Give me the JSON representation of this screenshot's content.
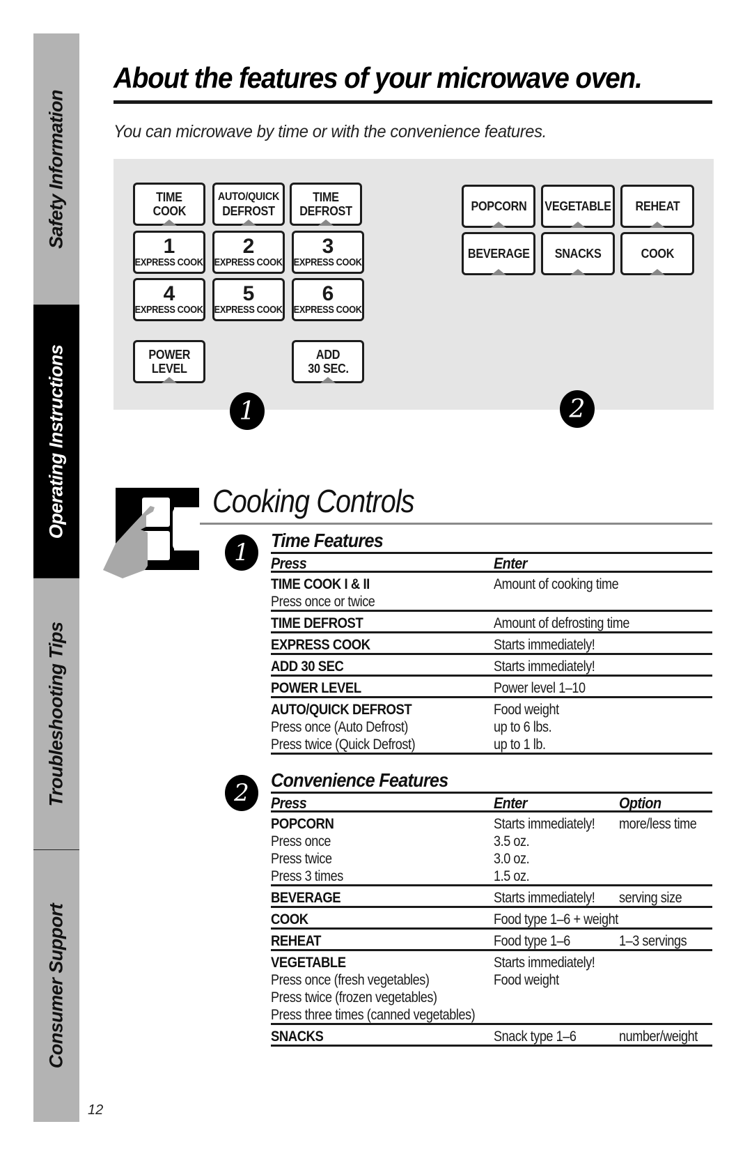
{
  "side_tabs": [
    {
      "label": "Safety Information",
      "active": false
    },
    {
      "label": "Operating Instructions",
      "active": true
    },
    {
      "label": "Troubleshooting Tips",
      "active": false
    },
    {
      "label": "Consumer Support",
      "active": false
    }
  ],
  "page_number": "12",
  "header": {
    "title": "About the features of your microwave oven.",
    "subtitle": "You can microwave by time or with the convenience features."
  },
  "panel": {
    "group1_badge": "1",
    "group2_badge": "2",
    "group1_keys": [
      {
        "line1": "TIME",
        "line2": "COOK"
      },
      {
        "line1": "AUTO/QUICK",
        "line2": "DEFROST"
      },
      {
        "line1": "TIME",
        "line2": "DEFROST"
      },
      {
        "num": "1",
        "sub": "EXPRESS COOK"
      },
      {
        "num": "2",
        "sub": "EXPRESS COOK"
      },
      {
        "num": "3",
        "sub": "EXPRESS COOK"
      },
      {
        "num": "4",
        "sub": "EXPRESS COOK"
      },
      {
        "num": "5",
        "sub": "EXPRESS COOK"
      },
      {
        "num": "6",
        "sub": "EXPRESS COOK"
      },
      {
        "line1": "POWER",
        "line2": "LEVEL"
      },
      {
        "line1": "ADD",
        "line2": "30 SEC."
      }
    ],
    "group2_keys": [
      {
        "label": "POPCORN"
      },
      {
        "label": "VEGETABLE"
      },
      {
        "label": "REHEAT"
      },
      {
        "label": "BEVERAGE"
      },
      {
        "label": "SNACKS"
      },
      {
        "label": "COOK"
      }
    ]
  },
  "cooking_controls": {
    "title": "Cooking Controls",
    "time_features": {
      "badge": "1",
      "title": "Time Features",
      "headers": {
        "press": "Press",
        "enter": "Enter"
      },
      "rows": [
        {
          "lines": [
            {
              "press": "TIME COOK I & II",
              "enter": "Amount of cooking time"
            },
            {
              "press": "Press once or twice",
              "enter": ""
            }
          ]
        },
        {
          "lines": [
            {
              "press": "TIME DEFROST",
              "enter": "Amount of defrosting time"
            }
          ]
        },
        {
          "lines": [
            {
              "press": "EXPRESS COOK",
              "enter": "Starts immediately!"
            }
          ]
        },
        {
          "lines": [
            {
              "press": "ADD 30 SEC",
              "enter": "Starts immediately!"
            }
          ]
        },
        {
          "lines": [
            {
              "press": "POWER LEVEL",
              "enter": "Power level 1–10"
            }
          ]
        },
        {
          "lines": [
            {
              "press": "AUTO/QUICK DEFROST",
              "enter": "Food weight"
            },
            {
              "press": "Press once (Auto Defrost)",
              "enter": "up to 6 lbs."
            },
            {
              "press": "Press twice (Quick Defrost)",
              "enter": "up to 1 lb."
            }
          ]
        }
      ]
    },
    "convenience_features": {
      "badge": "2",
      "title": "Convenience Features",
      "headers": {
        "press": "Press",
        "enter": "Enter",
        "option": "Option"
      },
      "rows": [
        {
          "lines": [
            {
              "press": "POPCORN",
              "enter": "Starts immediately!",
              "option": "more/less time"
            },
            {
              "press": "Press once",
              "enter": "3.5 oz.",
              "option": ""
            },
            {
              "press": "Press twice",
              "enter": "3.0 oz.",
              "option": ""
            },
            {
              "press": "Press 3 times",
              "enter": "1.5 oz.",
              "option": ""
            }
          ]
        },
        {
          "lines": [
            {
              "press": "BEVERAGE",
              "enter": "Starts immediately!",
              "option": "serving size"
            }
          ]
        },
        {
          "lines": [
            {
              "press": "COOK",
              "enter": "Food type 1–6 + weight",
              "option": ""
            }
          ]
        },
        {
          "lines": [
            {
              "press": "REHEAT",
              "enter": "Food type 1–6",
              "option": "1–3 servings"
            }
          ]
        },
        {
          "lines": [
            {
              "press": "VEGETABLE",
              "enter": "Starts immediately!",
              "option": ""
            },
            {
              "press": "Press once (fresh vegetables)",
              "enter": "Food weight",
              "option": ""
            },
            {
              "press": "Press twice (frozen vegetables)",
              "enter": "",
              "option": ""
            },
            {
              "press": "Press three times (canned vegetables)",
              "enter": "",
              "option": ""
            }
          ]
        },
        {
          "lines": [
            {
              "press": "SNACKS",
              "enter": "Snack type 1–6",
              "option": "number/weight"
            }
          ]
        }
      ]
    }
  }
}
